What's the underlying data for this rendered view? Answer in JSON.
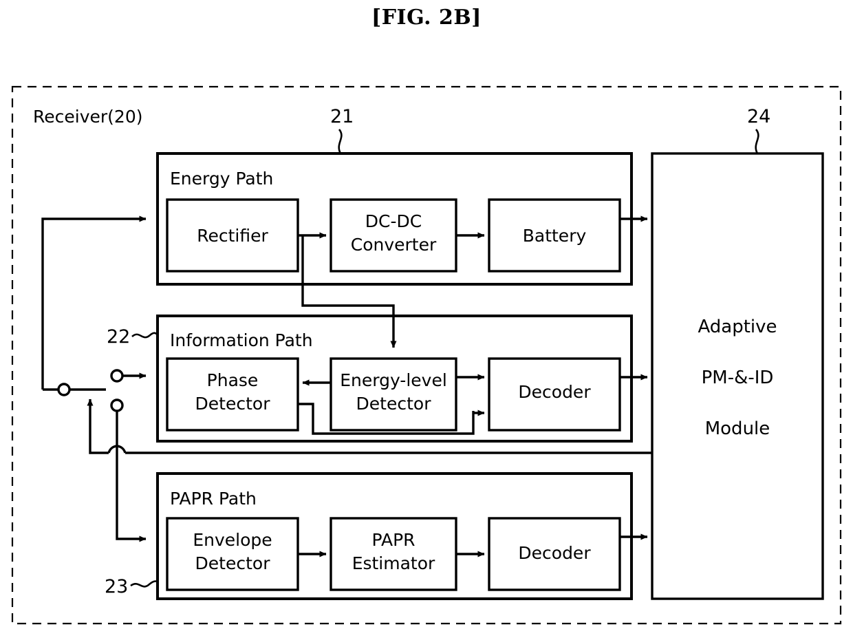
{
  "figure": {
    "title": "[FIG. 2B]",
    "receiver_label": "Receiver(20)"
  },
  "reference_numerals": {
    "energy_path": "21",
    "information_path": "22",
    "papr_path": "23",
    "module": "24"
  },
  "paths": {
    "energy": {
      "label": "Energy Path",
      "blocks": [
        {
          "name": "rectifier",
          "line1": "Rectifier",
          "line2": ""
        },
        {
          "name": "dc-dc-converter",
          "line1": "DC-DC",
          "line2": "Converter"
        },
        {
          "name": "battery",
          "line1": "Battery",
          "line2": ""
        }
      ]
    },
    "information": {
      "label": "Information Path",
      "blocks": [
        {
          "name": "phase-detector",
          "line1": "Phase",
          "line2": "Detector"
        },
        {
          "name": "energy-level-detector",
          "line1": "Energy-level",
          "line2": "Detector"
        },
        {
          "name": "decoder",
          "line1": "Decoder",
          "line2": ""
        }
      ]
    },
    "papr": {
      "label": "PAPR Path",
      "blocks": [
        {
          "name": "envelope-detector",
          "line1": "Envelope",
          "line2": "Detector"
        },
        {
          "name": "papr-estimator",
          "line1": "PAPR",
          "line2": "Estimator"
        },
        {
          "name": "decoder",
          "line1": "Decoder",
          "line2": ""
        }
      ]
    }
  },
  "module": {
    "line1": "Adaptive",
    "line2": "PM-&-ID",
    "line3": "Module"
  },
  "colors": {
    "stroke": "#000000",
    "background": "#ffffff"
  }
}
